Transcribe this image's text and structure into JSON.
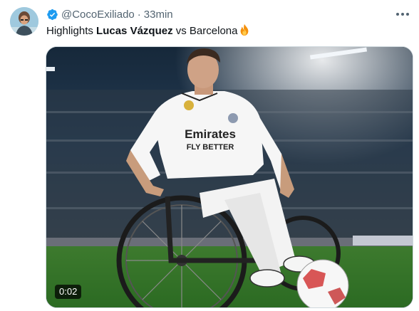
{
  "tweet": {
    "handle": "@CocoExiliado",
    "separator": "·",
    "time": "33min",
    "text_prefix": "Highlights ",
    "text_bold": "Lucas Vázquez",
    "text_suffix": " vs Barcelona",
    "emoji": "fire-emoji-icon",
    "verified_color": "#1d9bf0"
  },
  "media": {
    "duration": "0:02",
    "jersey_line1": "Emirates",
    "jersey_line2": "FLY BETTER"
  }
}
